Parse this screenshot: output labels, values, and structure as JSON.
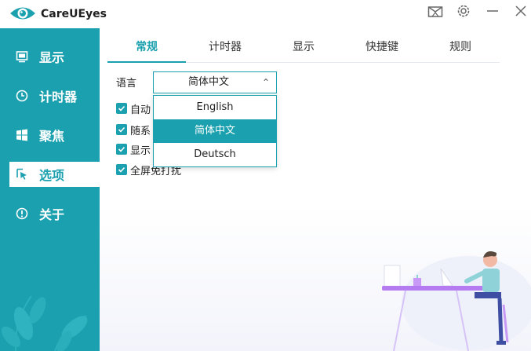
{
  "app": {
    "title": "CareUEyes"
  },
  "window_controls": {
    "mail": "mail-icon",
    "settings": "gear-icon",
    "minimize": "minimize-icon",
    "close": "close-icon"
  },
  "sidebar": {
    "items": [
      {
        "label": "显示",
        "icon": "display-icon",
        "active": false
      },
      {
        "label": "计时器",
        "icon": "clock-icon",
        "active": false
      },
      {
        "label": "聚焦",
        "icon": "windows-icon",
        "active": false
      },
      {
        "label": "选项",
        "icon": "cursor-icon",
        "active": true
      },
      {
        "label": "关于",
        "icon": "info-icon",
        "active": false
      }
    ]
  },
  "tabs": [
    {
      "label": "常规",
      "active": true
    },
    {
      "label": "计时器",
      "active": false
    },
    {
      "label": "显示",
      "active": false
    },
    {
      "label": "快捷键",
      "active": false
    },
    {
      "label": "规则",
      "active": false
    }
  ],
  "general": {
    "language_label": "语言",
    "language_value": "简体中文",
    "checkboxes": [
      {
        "label": "自动",
        "checked": true
      },
      {
        "label": "随系",
        "checked": true
      },
      {
        "label": "显示",
        "checked": true
      },
      {
        "label": "全屏免打扰",
        "checked": true
      }
    ],
    "language_options": [
      "English",
      "简体中文",
      "Deutsch"
    ],
    "selected_option": "简体中文"
  },
  "colors": {
    "accent": "#1aa0ae",
    "illustration_purple": "#b57bf0"
  }
}
